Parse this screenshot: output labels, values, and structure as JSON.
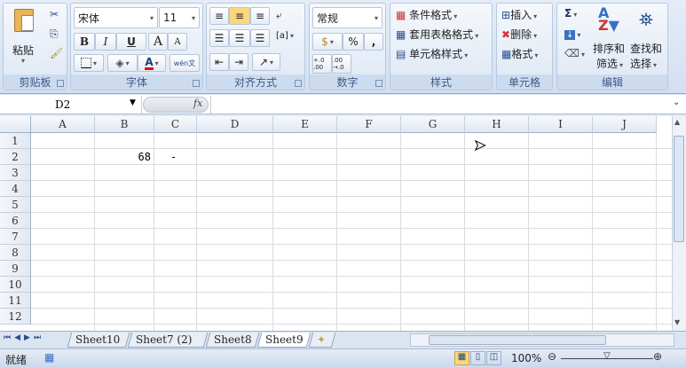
{
  "ribbon": {
    "clipboard": {
      "label": "剪贴板",
      "paste": "粘贴"
    },
    "font": {
      "label": "字体",
      "font_name": "宋体",
      "font_size": "11",
      "bold": "B",
      "italic": "I",
      "underline": "U",
      "grow": "A",
      "shrink": "A",
      "color_a": "A",
      "phonetic": "wén文"
    },
    "alignment": {
      "label": "对齐方式"
    },
    "number": {
      "label": "数字",
      "format": "常规",
      "percent": "%",
      "comma": ",",
      "inc_dec": "+.0 .00",
      "dec_dec": ".00 →.0"
    },
    "styles": {
      "label": "样式",
      "conditional": "条件格式",
      "table": "套用表格格式",
      "cell_styles": "单元格样式"
    },
    "cells": {
      "label": "单元格",
      "insert": "插入",
      "delete": "删除",
      "format": "格式"
    },
    "editing": {
      "label": "编辑",
      "sum": "Σ",
      "sort_line1": "排序和",
      "sort_line2": "筛选",
      "find_line1": "查找和",
      "find_line2": "选择"
    }
  },
  "formula_bar": {
    "name_box": "D2",
    "fx": "fx",
    "formula": ""
  },
  "grid": {
    "columns": [
      "A",
      "B",
      "C",
      "D",
      "E",
      "F",
      "G",
      "H",
      "I",
      "J"
    ],
    "rows": [
      "1",
      "2",
      "3",
      "4",
      "5",
      "6",
      "7",
      "8",
      "9",
      "10",
      "11",
      "12"
    ],
    "cells": {
      "B2": "68",
      "C2": "-"
    }
  },
  "sheets": {
    "tabs": [
      "Sheet10",
      "Sheet7 (2)",
      "Sheet8",
      "Sheet9"
    ],
    "active": "Sheet9"
  },
  "status": {
    "ready": "就绪",
    "zoom": "100%"
  }
}
